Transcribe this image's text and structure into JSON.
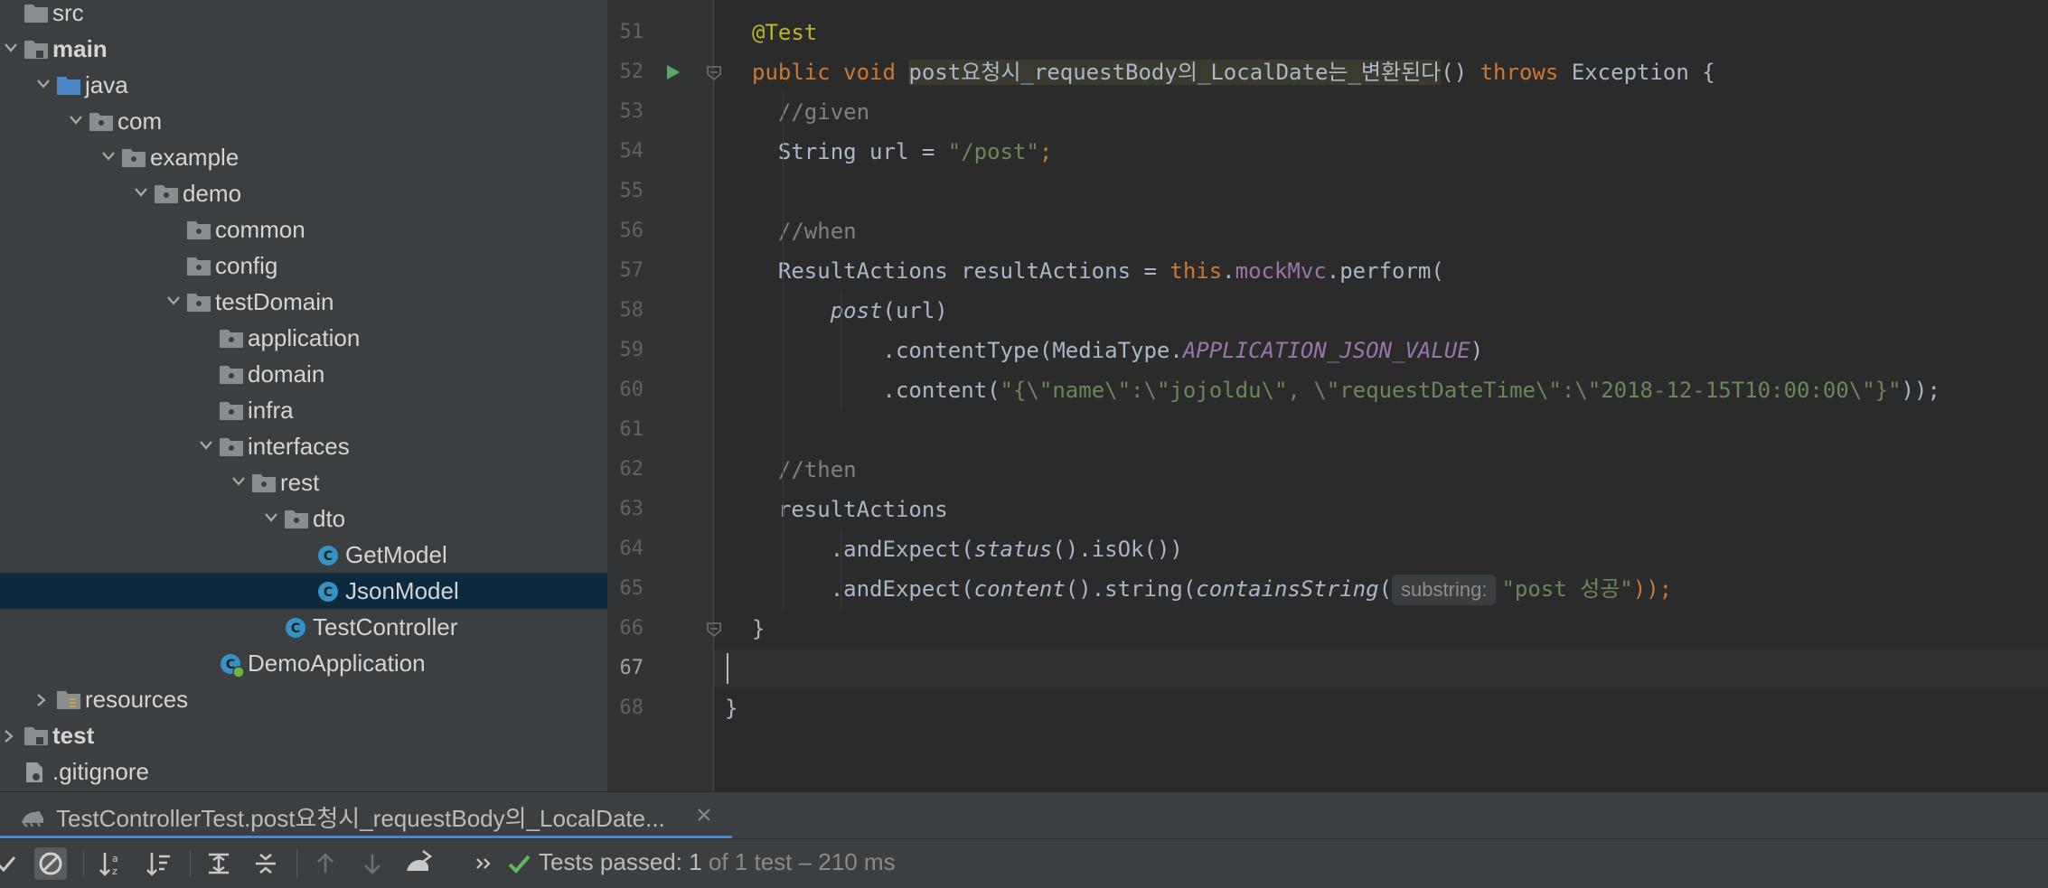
{
  "project_tree": {
    "items": [
      {
        "label": "src",
        "icon": "folder-icon",
        "expanded": null,
        "bold": false
      },
      {
        "label": "main",
        "icon": "source-folder-icon",
        "expanded": true,
        "bold": true
      },
      {
        "label": "java",
        "icon": "java-source-root-icon",
        "expanded": true,
        "bold": false
      },
      {
        "label": "com",
        "icon": "package-icon",
        "expanded": true,
        "bold": false
      },
      {
        "label": "example",
        "icon": "package-icon",
        "expanded": true,
        "bold": false
      },
      {
        "label": "demo",
        "icon": "package-icon",
        "expanded": true,
        "bold": false
      },
      {
        "label": "common",
        "icon": "package-icon",
        "expanded": null,
        "bold": false
      },
      {
        "label": "config",
        "icon": "package-icon",
        "expanded": null,
        "bold": false
      },
      {
        "label": "testDomain",
        "icon": "package-icon",
        "expanded": true,
        "bold": false
      },
      {
        "label": "application",
        "icon": "package-icon",
        "expanded": null,
        "bold": false
      },
      {
        "label": "domain",
        "icon": "package-icon",
        "expanded": null,
        "bold": false
      },
      {
        "label": "infra",
        "icon": "package-icon",
        "expanded": null,
        "bold": false
      },
      {
        "label": "interfaces",
        "icon": "package-icon",
        "expanded": true,
        "bold": false
      },
      {
        "label": "rest",
        "icon": "package-icon",
        "expanded": true,
        "bold": false
      },
      {
        "label": "dto",
        "icon": "package-icon",
        "expanded": true,
        "bold": false
      },
      {
        "label": "GetModel",
        "icon": "class-icon",
        "expanded": null,
        "bold": false
      },
      {
        "label": "JsonModel",
        "icon": "class-icon",
        "expanded": null,
        "bold": false,
        "selected": true
      },
      {
        "label": "TestController",
        "icon": "class-icon",
        "expanded": null,
        "bold": false
      },
      {
        "label": "DemoApplication",
        "icon": "spring-boot-class-icon",
        "expanded": null,
        "bold": false
      },
      {
        "label": "resources",
        "icon": "resources-folder-icon",
        "expanded": false,
        "bold": false
      },
      {
        "label": "test",
        "icon": "test-folder-icon",
        "expanded": false,
        "bold": true
      },
      {
        "label": ".gitignore",
        "icon": "gitignore-file-icon",
        "expanded": null,
        "bold": false
      }
    ]
  },
  "editor": {
    "current_line": 67,
    "lines": [
      {
        "num": "51",
        "tokens": [
          {
            "t": "@Test",
            "c": "ann"
          }
        ]
      },
      {
        "num": "52",
        "run_icon": true,
        "tokens": [
          {
            "t": "public void ",
            "c": "kw"
          },
          {
            "t": "post요청시_requestBody의_LocalDate는_변환된다",
            "c": "hl"
          },
          {
            "t": "() "
          },
          {
            "t": "throws ",
            "c": "kw"
          },
          {
            "t": "Exception {"
          }
        ]
      },
      {
        "num": "53",
        "tokens": [
          {
            "t": "  //given",
            "c": "cm"
          }
        ]
      },
      {
        "num": "54",
        "tokens": [
          {
            "t": "  String url = "
          },
          {
            "t": "\"/post\"",
            "c": "str"
          },
          {
            "t": ";",
            "c": "kw"
          }
        ]
      },
      {
        "num": "55",
        "tokens": []
      },
      {
        "num": "56",
        "tokens": [
          {
            "t": "  //when",
            "c": "cm"
          }
        ]
      },
      {
        "num": "57",
        "tokens": [
          {
            "t": "  ResultActions resultActions = "
          },
          {
            "t": "this",
            "c": "kw"
          },
          {
            "t": "."
          },
          {
            "t": "mockMvc",
            "c": "fld"
          },
          {
            "t": ".perform("
          }
        ]
      },
      {
        "num": "58",
        "tokens": [
          {
            "t": "      "
          },
          {
            "t": "post",
            "c": "it"
          },
          {
            "t": "(url)"
          }
        ]
      },
      {
        "num": "59",
        "tokens": [
          {
            "t": "          .contentType(MediaType."
          },
          {
            "t": "APPLICATION_JSON_VALUE",
            "c": "cst"
          },
          {
            "t": ")"
          }
        ]
      },
      {
        "num": "60",
        "tokens": [
          {
            "t": "          .content("
          },
          {
            "t": "\"{\\\"name\\\":\\\"jojoldu\\\", \\\"requestDateTime\\\":\\\"2018-12-15T10:00:00\\\"}\"",
            "c": "str"
          },
          {
            "t": "));"
          }
        ]
      },
      {
        "num": "61",
        "tokens": []
      },
      {
        "num": "62",
        "tokens": [
          {
            "t": "  //then",
            "c": "cm"
          }
        ]
      },
      {
        "num": "63",
        "tokens": [
          {
            "t": "  resultActions"
          }
        ]
      },
      {
        "num": "64",
        "tokens": [
          {
            "t": "      .andExpect("
          },
          {
            "t": "status",
            "c": "it"
          },
          {
            "t": "().isOk())"
          }
        ]
      },
      {
        "num": "65",
        "tokens": [
          {
            "t": "      .andExpect("
          },
          {
            "t": "content",
            "c": "it"
          },
          {
            "t": "().string("
          },
          {
            "t": "containsString",
            "c": "it"
          },
          {
            "t": "("
          },
          {
            "t": "substring:",
            "c": "hint"
          },
          {
            "t": "\"post 성공\"",
            "c": "str"
          },
          {
            "t": "));",
            "c": "kw"
          }
        ]
      },
      {
        "num": "66",
        "tokens": [
          {
            "t": "}"
          }
        ]
      },
      {
        "num": "67",
        "tokens": []
      },
      {
        "num": "68",
        "tokens": [
          {
            "t": "}"
          }
        ]
      }
    ]
  },
  "run_panel": {
    "tab_label": "TestControllerTest.post요청시_requestBody의_LocalDate...",
    "status": {
      "passed_prefix": "Tests passed: ",
      "passed_count": "1",
      "rest": " of 1 test – 210 ms"
    }
  },
  "colors": {
    "accent": "#4a88c7",
    "pass_green": "#5fb760",
    "selection": "#0d293e"
  }
}
